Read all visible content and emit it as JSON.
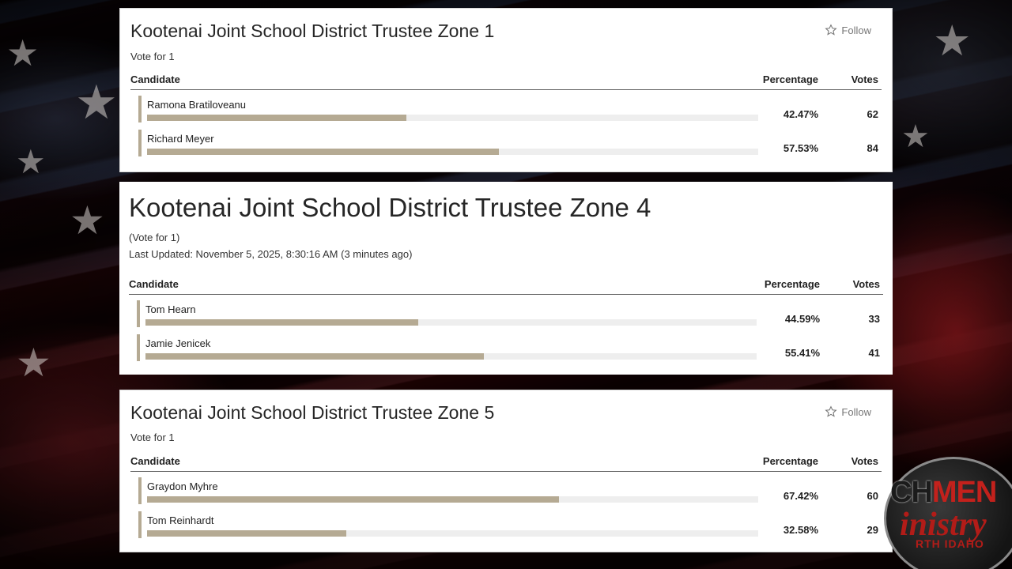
{
  "race_1": {
    "title": "Kootenai Joint School District Trustee Zone 1",
    "vote_for": "Vote for 1",
    "follow_label": "Follow",
    "columns": {
      "candidate": "Candidate",
      "percentage": "Percentage",
      "votes": "Votes"
    },
    "candidates": [
      {
        "name": "Ramona Bratiloveanu",
        "percentage": "42.47%",
        "votes": "62",
        "share": 0.4247
      },
      {
        "name": "Richard Meyer",
        "percentage": "57.53%",
        "votes": "84",
        "share": 0.5753
      }
    ]
  },
  "race_2": {
    "title": "Kootenai Joint School District Trustee Zone 4",
    "vote_for": "(Vote for 1)",
    "last_updated": "Last Updated: November 5, 2025, 8:30:16 AM (3 minutes ago)",
    "columns": {
      "candidate": "Candidate",
      "percentage": "Percentage",
      "votes": "Votes"
    },
    "candidates": [
      {
        "name": "Tom Hearn",
        "percentage": "44.59%",
        "votes": "33",
        "share": 0.4459
      },
      {
        "name": "Jamie Jenicek",
        "percentage": "55.41%",
        "votes": "41",
        "share": 0.5541
      }
    ]
  },
  "race_3": {
    "title": "Kootenai Joint School District Trustee Zone 5",
    "vote_for": "Vote for 1",
    "follow_label": "Follow",
    "columns": {
      "candidate": "Candidate",
      "percentage": "Percentage",
      "votes": "Votes"
    },
    "candidates": [
      {
        "name": "Graydon Myhre",
        "percentage": "67.42%",
        "votes": "60",
        "share": 0.6742
      },
      {
        "name": "Tom Reinhardt",
        "percentage": "32.58%",
        "votes": "29",
        "share": 0.3258
      }
    ]
  },
  "logo": {
    "line1_a": "CH",
    "line1_b": "MEN",
    "line2": "inistry",
    "line3": "RTH IDAHO"
  },
  "colors": {
    "bar_fill": "#b5aa93",
    "bar_track": "#eeeeee",
    "logo_red": "#c3211c"
  }
}
